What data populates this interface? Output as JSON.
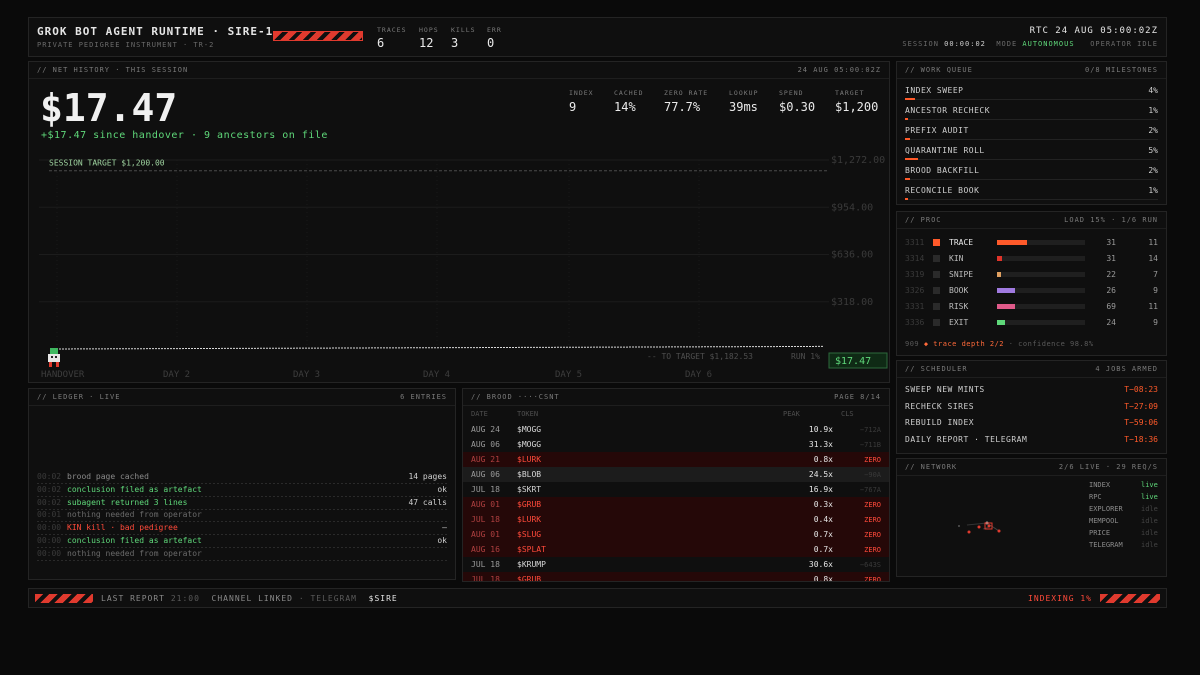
{
  "header": {
    "title": "GROK BOT AGENT RUNTIME · SIRE-1",
    "subtitle": "PRIVATE PEDIGREE INSTRUMENT · TR-2",
    "stats": [
      {
        "label": "TRACES",
        "value": "6"
      },
      {
        "label": "HOPS",
        "value": "12"
      },
      {
        "label": "KILLS",
        "value": "3"
      },
      {
        "label": "ERR",
        "value": "0"
      }
    ],
    "rtc": "RTC 24 AUG 05:00:02Z",
    "session_label": "SESSION",
    "session_value": "00:00:02",
    "mode_label": "MODE",
    "mode_value": "AUTONOMOUS",
    "operator": "OPERATOR IDLE"
  },
  "net": {
    "title": "// NET HISTORY · THIS SESSION",
    "timestamp": "24 AUG 05:00:02Z",
    "amount": "$17.47",
    "delta": "+$17.47 since handover · 9 ancestors on file",
    "stats": [
      {
        "label": "INDEX",
        "value": "9"
      },
      {
        "label": "CACHED",
        "value": "14%"
      },
      {
        "label": "ZERO RATE",
        "value": "77.7%"
      },
      {
        "label": "LOOKUP",
        "value": "39ms"
      },
      {
        "label": "SPEND",
        "value": "$0.30"
      },
      {
        "label": "TARGET",
        "value": "$1,200"
      }
    ]
  },
  "chart_data": {
    "type": "line",
    "target_label": "SESSION TARGET $1,200.00",
    "target_value": 1200,
    "y_ticks": [
      "$1,272.00",
      "$954.00",
      "$636.00",
      "$318.00"
    ],
    "x_labels": [
      "HANDOVER",
      "DAY 2",
      "DAY 3",
      "DAY 4",
      "DAY 5",
      "DAY 6"
    ],
    "ylim": [
      0,
      1272
    ],
    "series": [
      {
        "values": [
          0,
          17.47
        ]
      }
    ],
    "current_label": "$17.47",
    "to_target": "-- TO TARGET $1,182.53",
    "run_label": "RUN 1%"
  },
  "queue": {
    "title": "// WORK QUEUE",
    "count": "0/8 MILESTONES",
    "items": [
      {
        "name": "INDEX SWEEP",
        "pct": "4%",
        "fill": 0.04
      },
      {
        "name": "ANCESTOR RECHECK",
        "pct": "1%",
        "fill": 0.01
      },
      {
        "name": "PREFIX AUDIT",
        "pct": "2%",
        "fill": 0.02
      },
      {
        "name": "QUARANTINE ROLL",
        "pct": "5%",
        "fill": 0.05
      },
      {
        "name": "BROOD BACKFILL",
        "pct": "2%",
        "fill": 0.02
      },
      {
        "name": "RECONCILE BOOK",
        "pct": "1%",
        "fill": 0.01
      }
    ]
  },
  "proc": {
    "title": "// PROC",
    "load": "LOAD 15% · 1/6 RUN",
    "rows": [
      {
        "pid": "3311",
        "name": "TRACE",
        "color": "#ff5a2a",
        "fill": 0.34,
        "a": "31",
        "b": "11",
        "active": true
      },
      {
        "pid": "3314",
        "name": "KIN",
        "color": "#e0342a",
        "fill": 0.06,
        "a": "31",
        "b": "14",
        "active": false
      },
      {
        "pid": "3319",
        "name": "SNIPE",
        "color": "#e0a060",
        "fill": 0.04,
        "a": "22",
        "b": "7",
        "active": false
      },
      {
        "pid": "3326",
        "name": "BOOK",
        "color": "#a07ae0",
        "fill": 0.2,
        "a": "26",
        "b": "9",
        "active": false
      },
      {
        "pid": "3331",
        "name": "RISK",
        "color": "#e05a8a",
        "fill": 0.2,
        "a": "69",
        "b": "11",
        "active": false
      },
      {
        "pid": "3336",
        "name": "EXIT",
        "color": "#5fd87a",
        "fill": 0.09,
        "a": "24",
        "b": "9",
        "active": false
      }
    ],
    "footer_a": "909",
    "footer_b": "◆ trace depth 2/2",
    "footer_c": "· confidence 98.8%"
  },
  "scheduler": {
    "title": "// SCHEDULER",
    "count": "4 JOBS ARMED",
    "jobs": [
      {
        "name": "SWEEP NEW MINTS",
        "time": "T−08:23"
      },
      {
        "name": "RECHECK SIRES",
        "time": "T−27:09"
      },
      {
        "name": "REBUILD INDEX",
        "time": "T−59:06"
      },
      {
        "name": "DAILY REPORT · TELEGRAM",
        "time": "T−18:36"
      }
    ]
  },
  "network": {
    "title": "// NETWORK",
    "status": "2/6 LIVE · 29 REQ/S",
    "nodes": [
      {
        "name": "INDEX",
        "state": "live"
      },
      {
        "name": "RPC",
        "state": "live"
      },
      {
        "name": "EXPLORER",
        "state": "idle"
      },
      {
        "name": "MEMPOOL",
        "state": "idle"
      },
      {
        "name": "PRICE",
        "state": "idle"
      },
      {
        "name": "TELEGRAM",
        "state": "idle"
      }
    ]
  },
  "ledger": {
    "title": "// LEDGER · LIVE",
    "count": "6 ENTRIES",
    "entries": [
      {
        "time": "00:02",
        "text": "brood page cached",
        "value": "14 pages",
        "color": "#8a8a8a"
      },
      {
        "time": "00:02",
        "text": "conclusion filed as artefact",
        "value": "ok",
        "color": "#5fd87a"
      },
      {
        "time": "00:02",
        "text": "subagent returned 3 lines",
        "value": "47 calls",
        "color": "#5fd87a"
      },
      {
        "time": "00:01",
        "text": "nothing needed from operator",
        "value": "",
        "color": "#6a6a6a"
      },
      {
        "time": "00:00",
        "text": "KIN kill · bad pedigree",
        "value": "—",
        "color": "#ff4a3a"
      },
      {
        "time": "00:00",
        "text": "conclusion filed as artefact",
        "value": "ok",
        "color": "#5fd87a"
      },
      {
        "time": "00:00",
        "text": "nothing needed from operator",
        "value": "",
        "color": "#6a6a6a"
      }
    ]
  },
  "brood": {
    "title": "// BROOD ····CSNT",
    "page": "PAGE 8/14",
    "headers": [
      "DATE",
      "TOKEN",
      "PEAK",
      "CLS"
    ],
    "rows": [
      {
        "date": "AUG 24",
        "token": "$MOGG",
        "peak": "10.9x",
        "cls": "−712A",
        "zero": false
      },
      {
        "date": "AUG 06",
        "token": "$MOGG",
        "peak": "31.3x",
        "cls": "−711B",
        "zero": false
      },
      {
        "date": "AUG 21",
        "token": "$LURK",
        "peak": "0.8x",
        "cls": "ZERO",
        "zero": true
      },
      {
        "date": "AUG 06",
        "token": "$BLOB",
        "peak": "24.5x",
        "cls": "−90A",
        "zero": false
      },
      {
        "date": "JUL 18",
        "token": "$SKRT",
        "peak": "16.9x",
        "cls": "−767A",
        "zero": false
      },
      {
        "date": "AUG 01",
        "token": "$GRUB",
        "peak": "0.3x",
        "cls": "ZERO",
        "zero": true
      },
      {
        "date": "JUL 18",
        "token": "$LURK",
        "peak": "0.4x",
        "cls": "ZERO",
        "zero": true
      },
      {
        "date": "AUG 01",
        "token": "$SLUG",
        "peak": "0.7x",
        "cls": "ZERO",
        "zero": true
      },
      {
        "date": "AUG 16",
        "token": "$SPLAT",
        "peak": "0.7x",
        "cls": "ZERO",
        "zero": true
      },
      {
        "date": "JUL 18",
        "token": "$KRUMP",
        "peak": "30.6x",
        "cls": "−643S",
        "zero": false
      },
      {
        "date": "JUL 18",
        "token": "$GRUB",
        "peak": "0.8x",
        "cls": "ZERO",
        "zero": true
      }
    ]
  },
  "footer": {
    "last_report": "LAST REPORT",
    "report_time": "21:00",
    "channel": "CHANNEL LINKED",
    "channel_name": "· TELEGRAM",
    "ticker": "$SIRE",
    "indexing": "INDEXING 1%"
  }
}
